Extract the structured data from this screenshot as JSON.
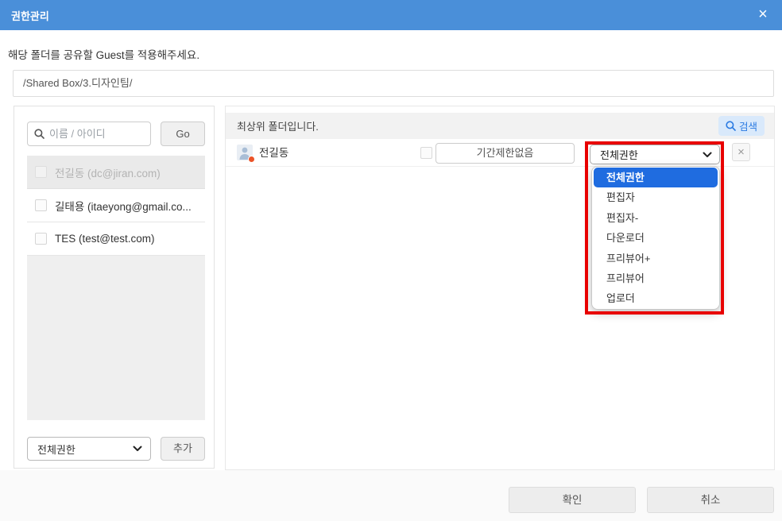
{
  "dialog": {
    "title": "권한관리",
    "close_glyph": "×"
  },
  "intro": {
    "instruction": "해당 폴더를 공유할 Guest를 적용해주세요.",
    "path": "/Shared Box/3.디자인팀/"
  },
  "left_panel": {
    "search_placeholder": "이름 / 아이디",
    "go_label": "Go",
    "users": [
      {
        "label": "전길동 (dc@jiran.com)"
      },
      {
        "label": "길태용 (itaeyong@gmail.co..."
      },
      {
        "label": "TES (test@test.com)"
      }
    ],
    "permission_value": "전체권한",
    "add_label": "추가"
  },
  "right_panel": {
    "header_text": "최상위 폴더입니다.",
    "search_label": "검색",
    "guest_row": {
      "name": "전길동",
      "period_label": "기간제한없음",
      "permission_value": "전체권한",
      "remove_glyph": "×"
    },
    "dropdown_options": [
      "전체권한",
      "편집자",
      "편집자-",
      "다운로더",
      "프리뷰어+",
      "프리뷰어",
      "업로더"
    ],
    "selected_option": "전체권한"
  },
  "footer": {
    "ok_label": "확인",
    "cancel_label": "취소"
  },
  "icons": {
    "titlebar_close": "close-icon",
    "search_field": "search-icon",
    "search_button": "search-icon",
    "selects": "chevron-down-icon",
    "guest_avatar": "person-icon",
    "annotation": "red-highlight-rectangle"
  },
  "colors": {
    "titlebar_blue": "#4a8fd9",
    "selected_option_blue": "#1f6ce0",
    "highlight_red": "#e80000",
    "search_button_bg": "#d9e9fb",
    "search_button_text": "#2a7ae2",
    "avatar_dot_orange": "#eb5328"
  }
}
